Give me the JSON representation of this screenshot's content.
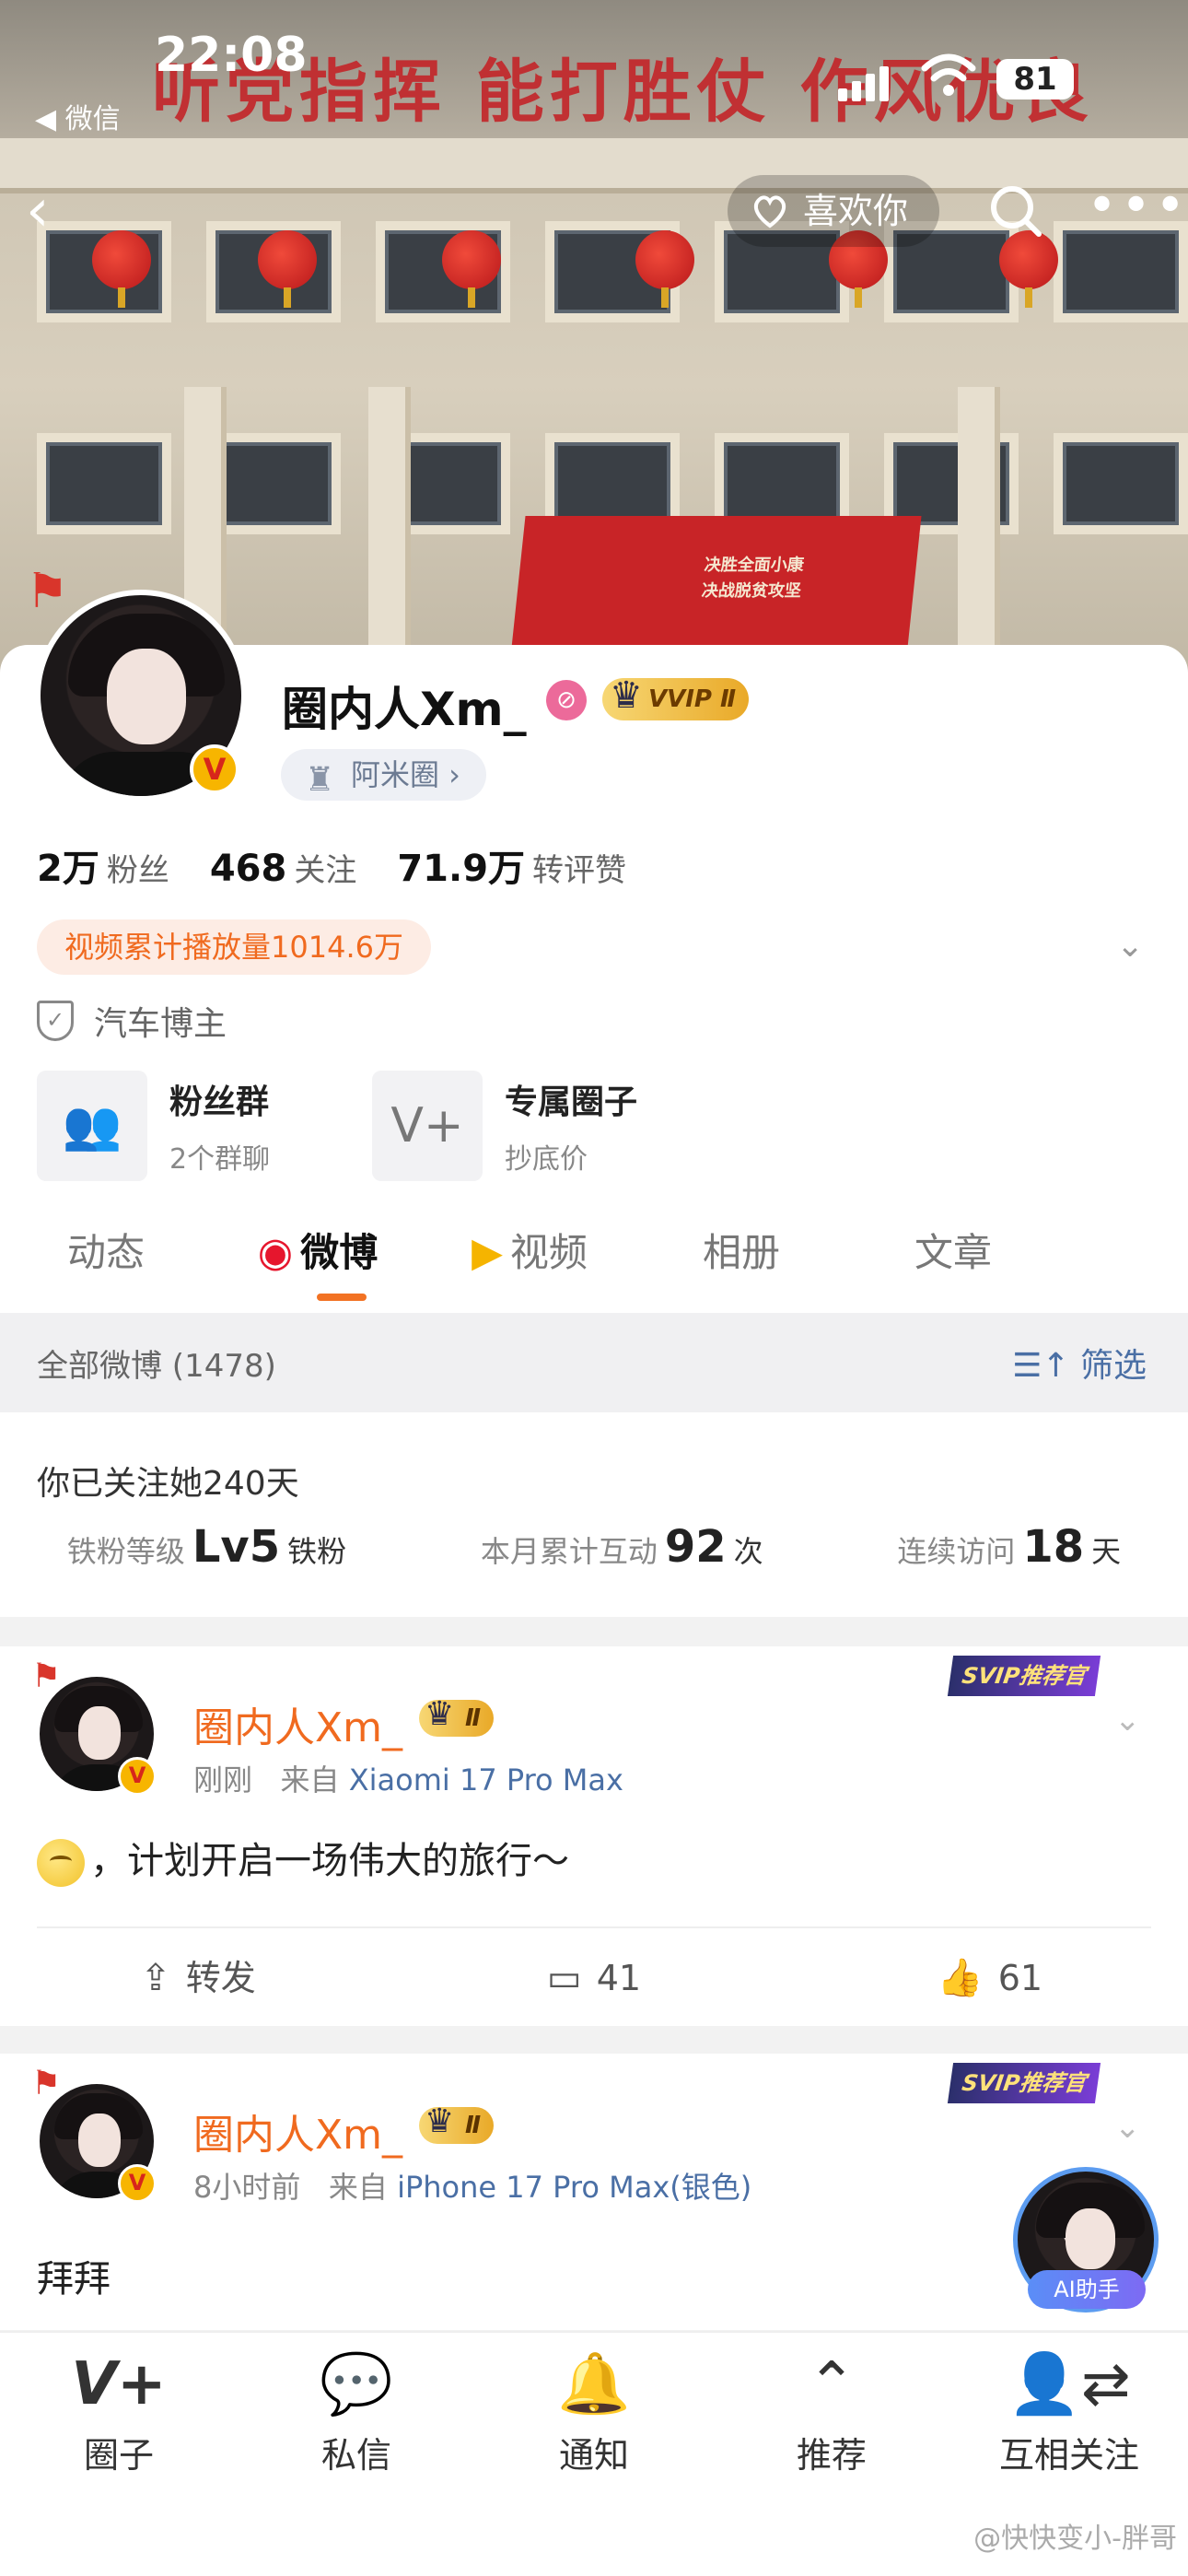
{
  "status_bar": {
    "time": "22:08",
    "back_app": "◀ 微信",
    "battery": "81"
  },
  "cover": {
    "banner_text": "听党指挥  能打胜仗  作风优良",
    "board_text": "决胜全面小康\n决战脱贫攻坚"
  },
  "nav": {
    "back_icon": "back-chevron-icon",
    "like_label": "喜欢你",
    "search_icon": "search-icon",
    "more_icon": "more-icon"
  },
  "profile": {
    "name": "圈内人Xm_",
    "vvip_badge": "VVIP Ⅱ",
    "verified_mark": "V",
    "circle_label": "阿米圈 ›",
    "stats": [
      {
        "value": "2万",
        "label": "粉丝"
      },
      {
        "value": "468",
        "label": "关注"
      },
      {
        "value": "71.9万",
        "label": "转评赞"
      }
    ],
    "video_plays": "视频累计播放量1014.6万",
    "blogger_tag": "汽车博主",
    "cards": [
      {
        "title": "粉丝群",
        "subtitle": "2个群聊",
        "icon": "fans-group-icon"
      },
      {
        "title": "专属圈子",
        "subtitle": "抄底价",
        "icon": "circle-icon"
      }
    ],
    "tabs": [
      "动态",
      "微博",
      "视频",
      "相册",
      "文章"
    ],
    "active_tab": "微博"
  },
  "filter": {
    "all_label": "全部微博 (1478)",
    "filter_label": "筛选"
  },
  "fan_info": {
    "follow_days": "你已关注她240天",
    "items": [
      {
        "label": "铁粉等级",
        "value": "Lv5",
        "unit": "铁粉"
      },
      {
        "label": "本月累计互动",
        "value": "92",
        "unit": "次"
      },
      {
        "label": "连续访问",
        "value": "18",
        "unit": "天"
      }
    ]
  },
  "posts": [
    {
      "author": "圈内人Xm_",
      "vip_badge": "Ⅱ",
      "svip_tag": "SVIP推荐官",
      "time": "刚刚",
      "source_prefix": "来自",
      "source": "Xiaomi 17 Pro Max",
      "text": "，计划开启一场伟大的旅行～",
      "repost_label": "转发",
      "comments": "41",
      "likes": "61"
    },
    {
      "author": "圈内人Xm_",
      "vip_badge": "Ⅱ",
      "svip_tag": "SVIP推荐官",
      "time": "8小时前",
      "source_prefix": "来自",
      "source": "iPhone 17 Pro Max(银色)",
      "text": "拜拜"
    }
  ],
  "ai_assistant": {
    "label": "AI助手"
  },
  "bottom_bar": [
    {
      "label": "圈子",
      "icon": "circle-plus-icon"
    },
    {
      "label": "私信",
      "icon": "message-icon"
    },
    {
      "label": "通知",
      "icon": "bell-icon"
    },
    {
      "label": "推荐",
      "icon": "recommend-icon"
    },
    {
      "label": "互相关注",
      "icon": "mutual-follow-icon"
    }
  ],
  "watermark": "@快快变小-胖哥",
  "colors": {
    "accent_orange": "#f27223",
    "name_orange": "#f06a1f",
    "link_blue": "#4a6fa5",
    "vip_gold": "#e9a928"
  }
}
